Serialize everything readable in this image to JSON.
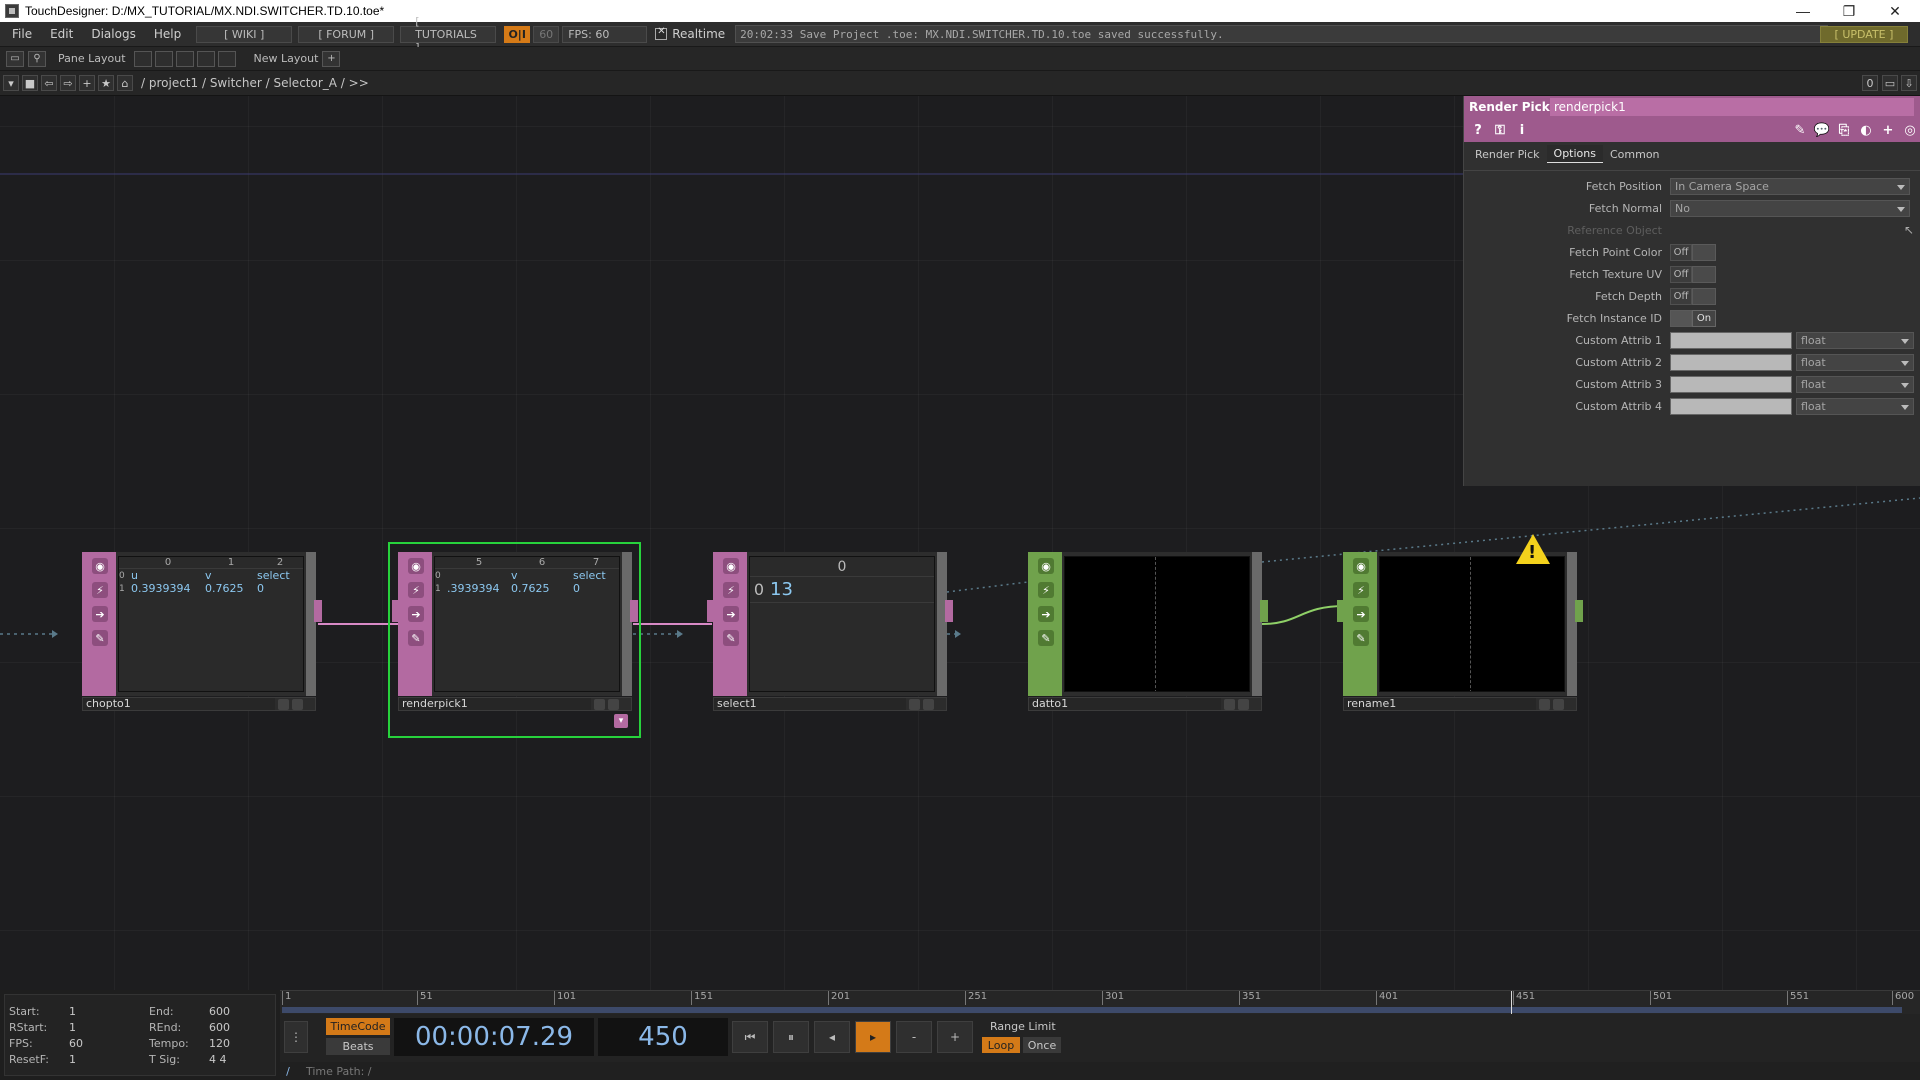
{
  "window": {
    "title": "TouchDesigner: D:/MX_TUTORIAL/MX.NDI.SWITCHER.TD.10.toe*",
    "minimize": "—",
    "restore": "❐",
    "close": "✕"
  },
  "menu": {
    "items": [
      "File",
      "Edit",
      "Dialogs",
      "Help"
    ],
    "wiki": "[ WIKI ]",
    "forum": "[ FORUM ]",
    "tutorials": "[ TUTORIALS ]",
    "oi": "O|I",
    "sixty": "60",
    "fps": "FPS:  60",
    "realtime": "Realtime",
    "status": "20:02:33 Save Project .toe: MX.NDI.SWITCHER.TD.10.toe saved successfully.",
    "update": "[ UPDATE ]"
  },
  "pane": {
    "pane_layout": "Pane Layout",
    "new_layout": "New Layout",
    "plus": "+"
  },
  "path": {
    "text": "/ project1 / Switcher / Selector_A / >>",
    "right_zero": "0"
  },
  "nodes": {
    "chopto1": {
      "name": "chopto1",
      "hdr": [
        "0",
        "1",
        "2"
      ],
      "cols": [
        "u",
        "v",
        "select"
      ],
      "row_idx": [
        "0",
        "1"
      ],
      "vals": [
        "0.3939394",
        "0.7625",
        "0"
      ]
    },
    "renderpick1": {
      "name": "renderpick1",
      "hdr": [
        "5",
        "6",
        "7"
      ],
      "cols": [
        "",
        "v",
        "select"
      ],
      "row_idx": [
        "0",
        "1"
      ],
      "vals": ".3939394",
      "v_val": "0.7625",
      "sel_val": "0"
    },
    "select1": {
      "name": "select1",
      "hdr": "0",
      "row": "0",
      "val": "13"
    },
    "datto1": {
      "name": "datto1"
    },
    "rename1": {
      "name": "rename1"
    }
  },
  "params": {
    "op_type": "Render Pick",
    "op_name": "renderpick1",
    "tabs": [
      "Render Pick",
      "Options",
      "Common"
    ],
    "active_tab": "Options",
    "rows": {
      "fetch_position": {
        "label": "Fetch Position",
        "value": "In Camera Space"
      },
      "fetch_normal": {
        "label": "Fetch Normal",
        "value": "No"
      },
      "reference_object": {
        "label": "Reference Object"
      },
      "fetch_point_color": {
        "label": "Fetch Point Color",
        "value": "Off"
      },
      "fetch_texture_uv": {
        "label": "Fetch Texture UV",
        "value": "Off"
      },
      "fetch_depth": {
        "label": "Fetch Depth",
        "value": "Off"
      },
      "fetch_instance_id": {
        "label": "Fetch Instance ID",
        "value": "On"
      },
      "custom_attrib_1": {
        "label": "Custom Attrib 1",
        "type": "float"
      },
      "custom_attrib_2": {
        "label": "Custom Attrib 2",
        "type": "float"
      },
      "custom_attrib_3": {
        "label": "Custom Attrib 3",
        "type": "float"
      },
      "custom_attrib_4": {
        "label": "Custom Attrib 4",
        "type": "float"
      }
    }
  },
  "ruler": {
    "ticks": [
      "1",
      "51",
      "101",
      "151",
      "201",
      "251",
      "301",
      "351",
      "401",
      "451",
      "501",
      "551",
      "600"
    ]
  },
  "stats": {
    "start_k": "Start:",
    "start_v": "1",
    "end_k": "End:",
    "end_v": "600",
    "rstart_k": "RStart:",
    "rstart_v": "1",
    "rend_k": "REnd:",
    "rend_v": "600",
    "fps_k": "FPS:",
    "fps_v": "60",
    "tempo_k": "Tempo:",
    "tempo_v": "120",
    "resetf_k": "ResetF:",
    "resetf_v": "1",
    "tsig_k": "T Sig:",
    "tsig_v": "4      4"
  },
  "transport": {
    "timecode_btn": "TimeCode",
    "beats_btn": "Beats",
    "timecode": "00:00:07.29",
    "frame": "450",
    "range_limit": "Range Limit",
    "loop": "Loop",
    "once": "Once",
    "minus": "-",
    "plus": "+"
  },
  "timepath": {
    "slash": "/",
    "label": "Time Path: /"
  },
  "colors": {
    "chop": "#b36aa1",
    "dat": "#70a24c",
    "selected": "#27d23c",
    "accent_orange": "#d47a18"
  }
}
